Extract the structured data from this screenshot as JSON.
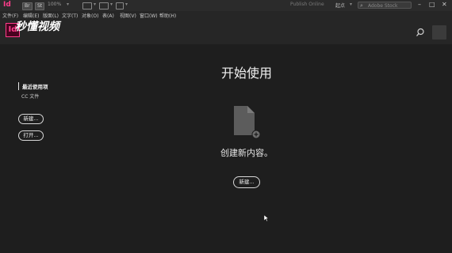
{
  "toolbar": {
    "app_icon_letter": "Id",
    "br_chip": "Br",
    "st_chip": "St",
    "zoom": "100%",
    "publish": "Publish Online",
    "start": "起点",
    "search_placeholder": "Adobe Stock"
  },
  "menu": [
    "文件(F)",
    "编辑(E)",
    "版面(L)",
    "文字(T)",
    "对象(O)",
    "表(A)",
    "视图(V)",
    "窗口(W)",
    "帮助(H)"
  ],
  "watermark": "秒懂视频",
  "header": {
    "logo_letter": "Id"
  },
  "sidebar": {
    "recent_title": "最近使用项",
    "cc_files": "CC 文件",
    "new_label": "新建...",
    "open_label": "打开..."
  },
  "main": {
    "title": "开始使用",
    "create_text": "创建新内容。",
    "new_label": "新建..."
  },
  "colors": {
    "accent": "#ff3d8b",
    "background": "#1e1e1e"
  }
}
